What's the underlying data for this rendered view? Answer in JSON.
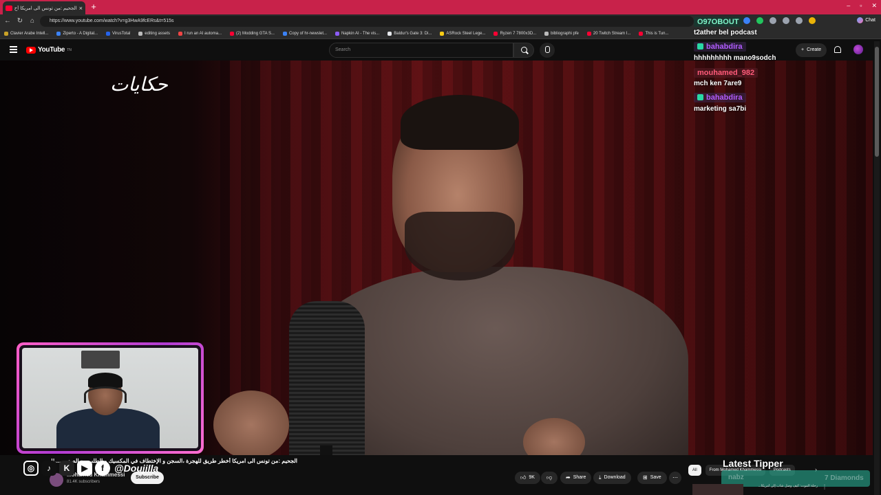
{
  "browser": {
    "tab_title": "الجحيم :من تونس الى امريكا أخ",
    "url": "https://www.youtube.com/watch?v=g3HwA9fcERs&t=515s",
    "chat_label": "Chat",
    "bookmarks": [
      {
        "label": "Clavier Arabe Intell...",
        "color": "#c9a227"
      },
      {
        "label": "Ziperto - A Digital...",
        "color": "#3b82f6"
      },
      {
        "label": "VirusTotal",
        "color": "#2563eb"
      },
      {
        "label": "editing assets",
        "color": "#bbbbbb"
      },
      {
        "label": "I run an AI automa...",
        "color": "#ef4444"
      },
      {
        "label": "(2) Modding GTA S...",
        "color": "#ff0033"
      },
      {
        "label": "Copy of hr-newslet...",
        "color": "#3b82f6"
      },
      {
        "label": "Napkin AI - The vis...",
        "color": "#8b5cf6"
      },
      {
        "label": "Baldur's Gate 3: Di...",
        "color": "#e5e7eb"
      },
      {
        "label": "ASRock Steel Lege...",
        "color": "#facc15"
      },
      {
        "label": "Ryzen 7 7800x3D...",
        "color": "#ff0033"
      },
      {
        "label": "bibliographi pfe",
        "color": "#bbbbbb"
      },
      {
        "label": "20 Twitch Stream I...",
        "color": "#ff0033"
      },
      {
        "label": "This is Tun...",
        "color": "#ff0033"
      }
    ]
  },
  "youtube": {
    "logo_text": "YouTube",
    "logo_sup": "TN",
    "search_placeholder": "Search",
    "create_label": "Create"
  },
  "video": {
    "watermark": "حكايات",
    "title": "الجحيم :من تونس الى امريكا أخطر طريق للهجرة ،السجن و الإختطاف في المكسيك و الطلب مع الصدر ......!!",
    "channel_name": "Mohamed Khammessi",
    "channel_subs": "81.4K subscribers",
    "subscribe_label": "Subscribe",
    "likes": "9K",
    "share_label": "Share",
    "download_label": "Download",
    "save_label": "Save"
  },
  "chat": {
    "header_user": "O97OBOUT",
    "header_message": "t2ather bel podcast",
    "messages": [
      {
        "user": "bahabdira",
        "text": "hhhhhhhhh mano9sodch",
        "color": "#b15cff",
        "bg": "rgba(60,40,80,0.55)",
        "badge": true
      },
      {
        "user": "mouhamed_982",
        "text": "mch ken 7are9",
        "color": "#ff5b7a",
        "bg": "rgba(90,30,40,0.55)",
        "badge": false
      },
      {
        "user": "bahabdira",
        "text": "marketing sa7bi",
        "color": "#b15cff",
        "bg": "rgba(60,40,80,0.55)",
        "badge": true
      }
    ]
  },
  "socials": {
    "handle": "@Doujilla"
  },
  "recommendations": {
    "tabs": [
      "All",
      "From Mohamed Khammessi",
      "Podcasts"
    ],
    "first_title": "رحلة الموت: كيف وصل شاب إلى أمريكا..."
  },
  "tipper": {
    "heading": "Latest Tipper",
    "name": "nabz",
    "amount": "7 Diamonds"
  }
}
